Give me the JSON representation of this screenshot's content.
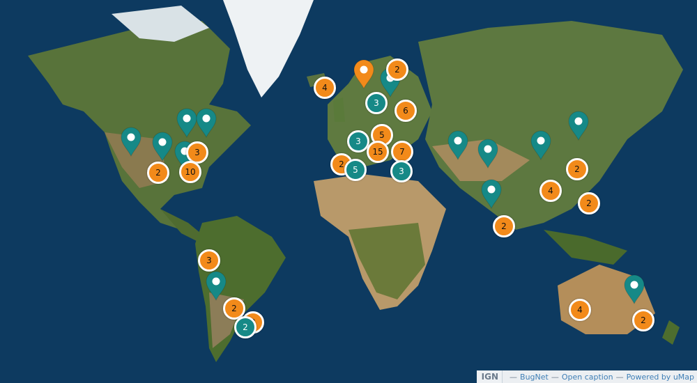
{
  "colors": {
    "ocean": "#0d3a60",
    "land": "#5e7a3c",
    "desert": "#b59a68",
    "ice": "#e9eef2",
    "pin_teal": "#168987",
    "pin_orange": "#f28a1a"
  },
  "attribution": {
    "logo": "IGN",
    "items": [
      "BugNet",
      "Open caption",
      "Powered by uMap"
    ]
  },
  "markers": [
    {
      "type": "pin",
      "color": "orange"
    },
    {
      "type": "pin",
      "color": "teal"
    },
    {
      "type": "pin",
      "color": "teal"
    },
    {
      "type": "pin",
      "color": "teal"
    },
    {
      "type": "pin",
      "color": "teal"
    },
    {
      "type": "pin",
      "color": "teal"
    },
    {
      "type": "pin",
      "color": "teal"
    },
    {
      "type": "pin",
      "color": "teal"
    },
    {
      "type": "pin",
      "color": "teal"
    },
    {
      "type": "pin",
      "color": "teal"
    },
    {
      "type": "pin",
      "color": "teal"
    },
    {
      "type": "pin",
      "color": "teal"
    },
    {
      "type": "pin",
      "color": "teal"
    },
    {
      "type": "pin",
      "color": "teal"
    }
  ],
  "clusters": [
    {
      "count": "4",
      "color": "orange"
    },
    {
      "count": "2",
      "color": "orange"
    },
    {
      "count": "3",
      "color": "teal"
    },
    {
      "count": "6",
      "color": "orange"
    },
    {
      "count": "5",
      "color": "orange"
    },
    {
      "count": "3",
      "color": "teal"
    },
    {
      "count": "15",
      "color": "orange"
    },
    {
      "count": "7",
      "color": "orange"
    },
    {
      "count": "2",
      "color": "orange"
    },
    {
      "count": "5",
      "color": "teal"
    },
    {
      "count": "3",
      "color": "teal"
    },
    {
      "count": "3",
      "color": "orange"
    },
    {
      "count": "2",
      "color": "orange"
    },
    {
      "count": "10",
      "color": "orange"
    },
    {
      "count": "2",
      "color": "orange"
    },
    {
      "count": "4",
      "color": "orange"
    },
    {
      "count": "2",
      "color": "orange"
    },
    {
      "count": "2",
      "color": "orange"
    },
    {
      "count": "3",
      "color": "orange"
    },
    {
      "count": "2",
      "color": "orange"
    },
    {
      "count": "2",
      "color": "orange"
    },
    {
      "count": "2",
      "color": "teal"
    },
    {
      "count": "4",
      "color": "orange"
    },
    {
      "count": "2",
      "color": "orange"
    }
  ]
}
